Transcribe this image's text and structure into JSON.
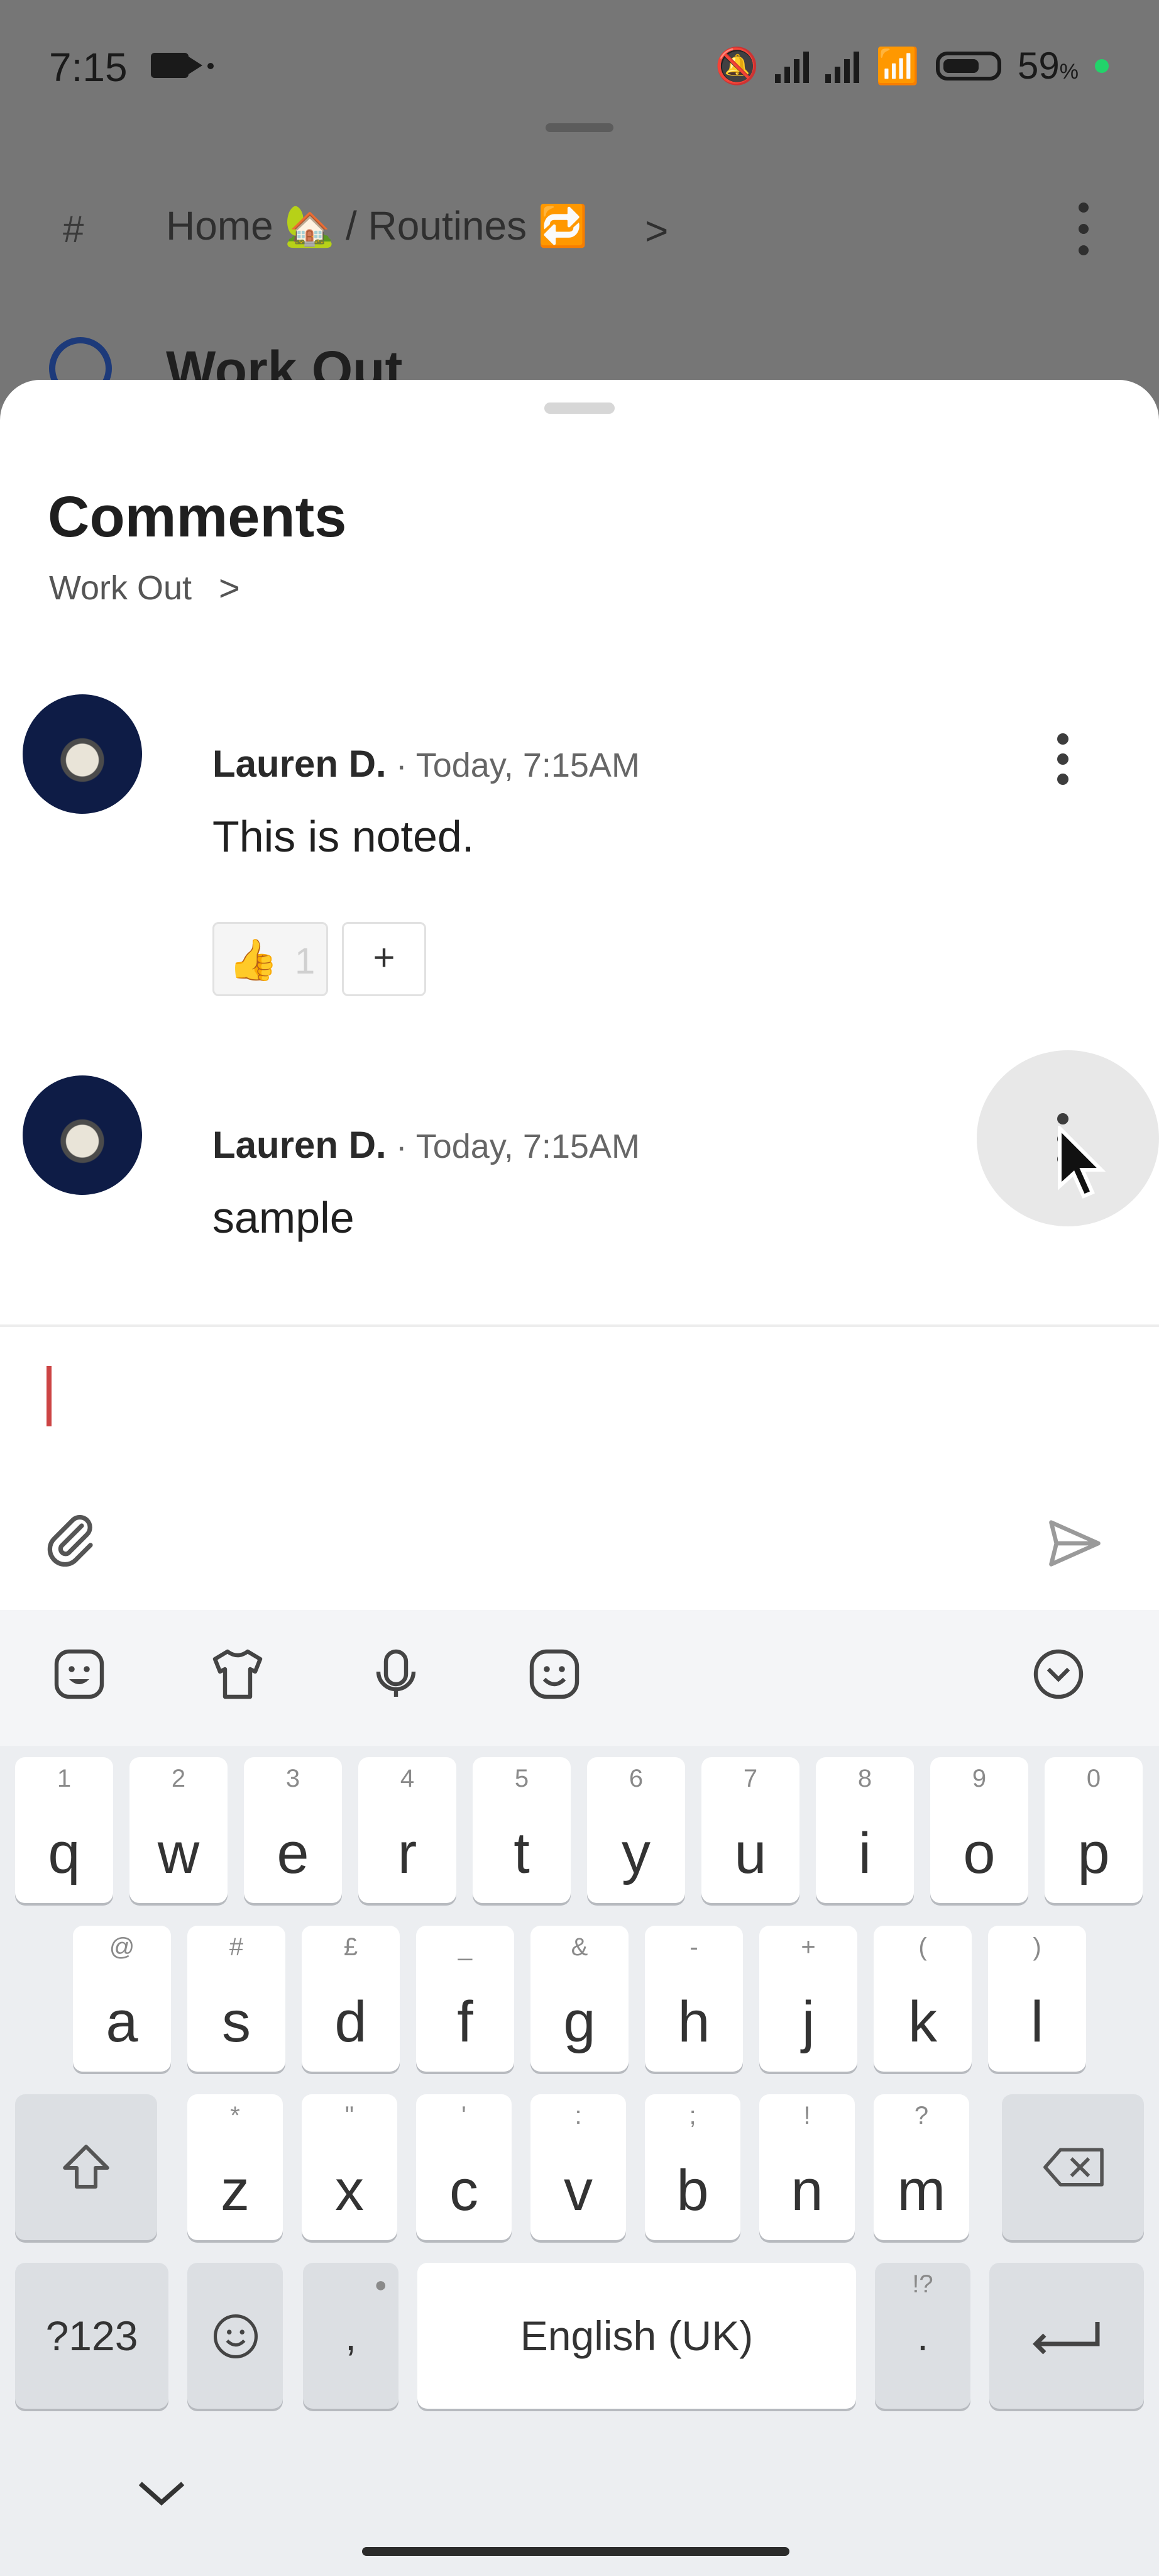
{
  "status_bar": {
    "time": "7:15",
    "battery": "59",
    "battery_unit": "%"
  },
  "background": {
    "hash": "#",
    "breadcrumb": "Home 🏡 / Routines 🔁",
    "chevron": ">",
    "task_title": "Work Out"
  },
  "sheet": {
    "title": "Comments",
    "subtitle": "Work Out",
    "subtitle_chevron": ">"
  },
  "comments": [
    {
      "author": "Lauren D.",
      "time": " · Today, 7:15AM",
      "text": "This is noted.",
      "reaction_emoji": "👍",
      "reaction_count": "1",
      "add_reaction": "+"
    },
    {
      "author": "Lauren D.",
      "time": " · Today, 7:15AM",
      "text": "sample"
    }
  ],
  "keyboard": {
    "row1": [
      [
        "q",
        "1"
      ],
      [
        "w",
        "2"
      ],
      [
        "e",
        "3"
      ],
      [
        "r",
        "4"
      ],
      [
        "t",
        "5"
      ],
      [
        "y",
        "6"
      ],
      [
        "u",
        "7"
      ],
      [
        "i",
        "8"
      ],
      [
        "o",
        "9"
      ],
      [
        "p",
        "0"
      ]
    ],
    "row2": [
      [
        "a",
        "@"
      ],
      [
        "s",
        "#"
      ],
      [
        "d",
        "£"
      ],
      [
        "f",
        "_"
      ],
      [
        "g",
        "&"
      ],
      [
        "h",
        "-"
      ],
      [
        "j",
        "+"
      ],
      [
        "k",
        "("
      ],
      [
        "l",
        ")"
      ]
    ],
    "row3": [
      [
        "z",
        "*"
      ],
      [
        "x",
        "\""
      ],
      [
        "c",
        "'"
      ],
      [
        "v",
        ":"
      ],
      [
        "b",
        ";"
      ],
      [
        "n",
        "!"
      ],
      [
        "m",
        "?"
      ]
    ],
    "symbols_key": "?123",
    "comma": ",",
    "space": "English (UK)",
    "period": ".",
    "period_hint": "!?"
  },
  "colors": {
    "accent": "#c44444",
    "sheet_bg": "#ffffff",
    "dim_bg": "#767676"
  }
}
